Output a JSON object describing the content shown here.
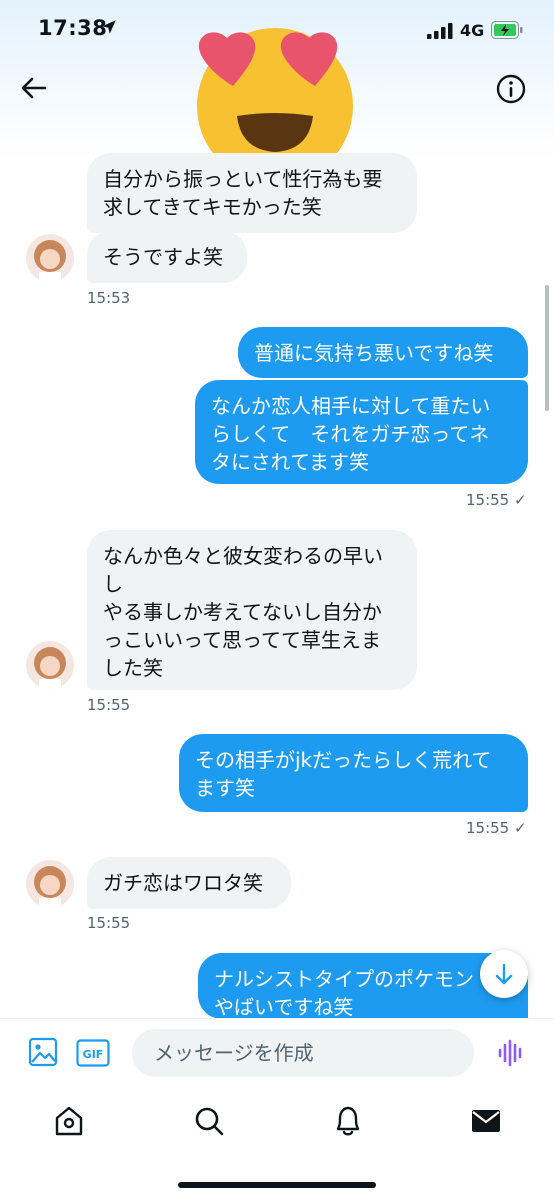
{
  "status_bar": {
    "time": "17:38",
    "network": "4G",
    "icons": [
      "location-arrow-icon",
      "signal-bars-icon",
      "battery-charging-icon"
    ]
  },
  "header": {
    "icons": [
      "back-arrow-icon",
      "info-icon"
    ]
  },
  "overlay": {
    "icon": "heart-eyes-emoji",
    "colors": {
      "face": "#f7c132",
      "hearts": "#e8546c",
      "mouth": "#5a3512"
    }
  },
  "messages": [
    {
      "from": "them",
      "text": "自分から振っといて性行為も要\n求してきてキモかった笑"
    },
    {
      "from": "them",
      "text": "そうですよ笑",
      "time": "15:53"
    },
    {
      "from": "me",
      "text": "普通に気持ち悪いですね笑"
    },
    {
      "from": "me",
      "text": "なんか恋人相手に対して重たい\nらしくて　それをガチ恋ってネ\nタにされてます笑",
      "time": "15:55 ✓"
    },
    {
      "from": "them",
      "text": "なんか色々と彼女変わるの早い\nし\nやる事しか考えてないし自分か\nっこいいって思ってて草生えま\nした笑",
      "time": "15:55"
    },
    {
      "from": "me",
      "text": "その相手がjkだったらしく荒れて\nます笑",
      "time": "15:55 ✓"
    },
    {
      "from": "them",
      "text": "ガチ恋はワロタ笑",
      "time": "15:55"
    },
    {
      "from": "me",
      "text": "ナルシストタイプのポケモン\nやばいですね笑"
    }
  ],
  "composer": {
    "placeholder": "メッセージを作成",
    "gif_label": "GIF"
  },
  "tabs": [
    "home-icon",
    "search-icon",
    "notifications-icon",
    "messages-icon"
  ],
  "colors": {
    "accent": "#1d9bf0",
    "incoming_bubble": "#eff3f4",
    "text": "#0f1419",
    "muted": "#536471"
  }
}
